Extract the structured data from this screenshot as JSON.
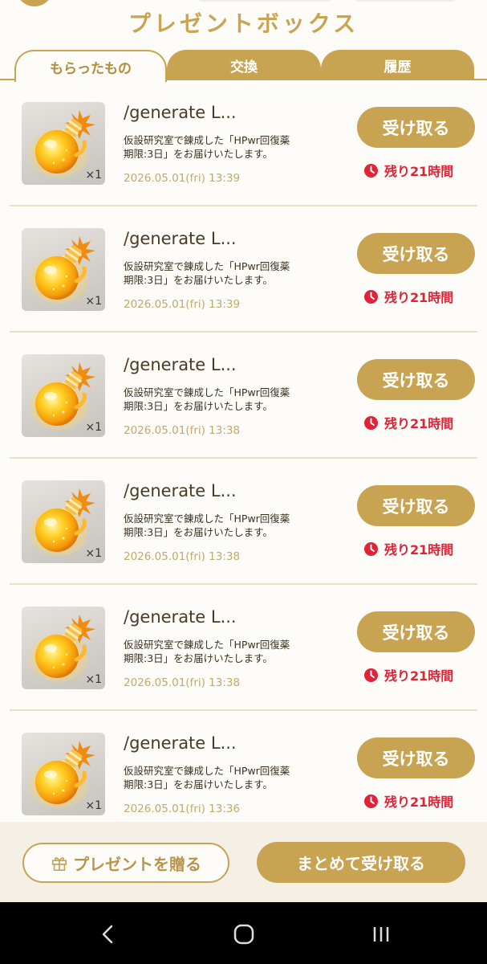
{
  "header": {
    "title": "プレゼントボックス"
  },
  "tabs": [
    {
      "label": "もらったもの",
      "active": true
    },
    {
      "label": "交換",
      "active": false
    },
    {
      "label": "履歴",
      "active": false
    }
  ],
  "items": [
    {
      "name": "/generate L...",
      "desc_line1": "仮設研究室で錬成した「HPwr回復薬",
      "desc_line2": "期限:3日」をお届けいたします。",
      "date": "2026.05.01(fri) 13:39",
      "qty": "×1",
      "button": "受け取る",
      "remaining": "残り21時間"
    },
    {
      "name": "/generate L...",
      "desc_line1": "仮設研究室で錬成した「HPwr回復薬",
      "desc_line2": "期限:3日」をお届けいたします。",
      "date": "2026.05.01(fri) 13:39",
      "qty": "×1",
      "button": "受け取る",
      "remaining": "残り21時間"
    },
    {
      "name": "/generate L...",
      "desc_line1": "仮設研究室で錬成した「HPwr回復薬",
      "desc_line2": "期限:3日」をお届けいたします。",
      "date": "2026.05.01(fri) 13:38",
      "qty": "×1",
      "button": "受け取る",
      "remaining": "残り21時間"
    },
    {
      "name": "/generate L...",
      "desc_line1": "仮設研究室で錬成した「HPwr回復薬",
      "desc_line2": "期限:3日」をお届けいたします。",
      "date": "2026.05.01(fri) 13:38",
      "qty": "×1",
      "button": "受け取る",
      "remaining": "残り21時間"
    },
    {
      "name": "/generate L...",
      "desc_line1": "仮設研究室で錬成した「HPwr回復薬",
      "desc_line2": "期限:3日」をお届けいたします。",
      "date": "2026.05.01(fri) 13:38",
      "qty": "×1",
      "button": "受け取る",
      "remaining": "残り21時間"
    },
    {
      "name": "/generate L...",
      "desc_line1": "仮設研究室で錬成した「HPwr回復薬",
      "desc_line2": "期限:3日」をお届けいたします。",
      "date": "2026.05.01(fri) 13:36",
      "qty": "×1",
      "button": "受け取る",
      "remaining": "残り21時間"
    }
  ],
  "footer": {
    "gift_label": "プレゼントを贈る",
    "receive_all_label": "まとめて受け取る"
  },
  "colors": {
    "accent": "#c8a351",
    "remaining": "#e02437",
    "date": "#c2a86c"
  },
  "icons": {
    "item": "potion-icon",
    "remaining": "clock-icon",
    "gift": "gift-icon",
    "nav": [
      "back-icon",
      "home-icon",
      "recents-icon"
    ]
  }
}
